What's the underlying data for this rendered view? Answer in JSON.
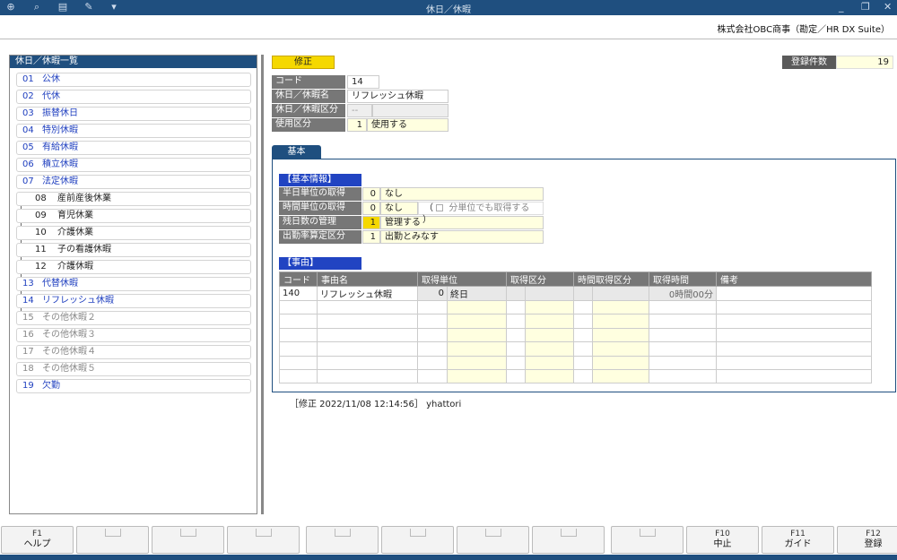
{
  "window": {
    "title": "休日／休暇"
  },
  "toolbar": {
    "icons": [
      "zoom-in-icon",
      "search-icon",
      "print-icon",
      "tools-icon",
      "dropdown-icon"
    ]
  },
  "company": "株式会社OBC商事（勘定／HR DX Suite）",
  "left_panel": {
    "title": "休日／休暇一覧",
    "items": [
      {
        "code": "01",
        "name": "公休"
      },
      {
        "code": "02",
        "name": "代休"
      },
      {
        "code": "03",
        "name": "振替休日"
      },
      {
        "code": "04",
        "name": "特別休暇"
      },
      {
        "code": "05",
        "name": "有給休暇"
      },
      {
        "code": "06",
        "name": "積立休暇"
      },
      {
        "code": "07",
        "name": "法定休暇"
      },
      {
        "code": "08",
        "name": "産前産後休業"
      },
      {
        "code": "09",
        "name": "育児休業"
      },
      {
        "code": "10",
        "name": "介護休業"
      },
      {
        "code": "11",
        "name": "子の看護休暇"
      },
      {
        "code": "12",
        "name": "介護休暇"
      },
      {
        "code": "13",
        "name": "代替休暇"
      },
      {
        "code": "14",
        "name": "リフレッシュ休暇"
      },
      {
        "code": "15",
        "name": "その他休暇２"
      },
      {
        "code": "16",
        "name": "その他休暇３"
      },
      {
        "code": "17",
        "name": "その他休暇４"
      },
      {
        "code": "18",
        "name": "その他休暇５"
      },
      {
        "code": "19",
        "name": "欠勤"
      }
    ]
  },
  "mode": "修正",
  "count": {
    "label": "登録件数",
    "value": "19"
  },
  "header_fields": {
    "code_label": "コード",
    "code_value": "14",
    "name_label": "休日／休暇名",
    "name_value": "リフレッシュ休暇",
    "kbn_label": "休日／休暇区分",
    "kbn_value": "--",
    "use_label": "使用区分",
    "use_num": "1",
    "use_value": "使用する"
  },
  "tab": "基本",
  "basic": {
    "section": "【基本情報】",
    "rows": [
      {
        "label": "半日単位の取得",
        "num": "0",
        "value": "なし"
      },
      {
        "label": "時間単位の取得",
        "num": "0",
        "value": "なし"
      },
      {
        "label": "残日数の管理",
        "num": "1",
        "value": "管理する"
      },
      {
        "label": "出勤率算定区分",
        "num": "1",
        "value": "出勤とみなす"
      }
    ],
    "checkbox_label": "分単位でも取得する",
    "paren_open": "（",
    "paren_close": "）"
  },
  "jiyu": {
    "section": "【事由】",
    "columns": [
      "コード",
      "事由名",
      "取得単位",
      "取得区分",
      "時間取得区分",
      "取得時間",
      "備考"
    ],
    "row": {
      "code": "140",
      "name": "リフレッシュ休暇",
      "unit_num": "0",
      "unit": "終日",
      "time": "0時間00分"
    }
  },
  "footer_info": "［修正  2022/11/08 12:14:56］ yhattori",
  "fkeys": [
    {
      "n": "F1",
      "l": "ヘルプ"
    },
    {
      "n": "",
      "l": ""
    },
    {
      "n": "",
      "l": ""
    },
    {
      "n": "",
      "l": ""
    },
    {
      "n": "",
      "l": ""
    },
    {
      "n": "",
      "l": ""
    },
    {
      "n": "",
      "l": ""
    },
    {
      "n": "",
      "l": ""
    },
    {
      "n": "",
      "l": ""
    },
    {
      "n": "F10",
      "l": "中止"
    },
    {
      "n": "F11",
      "l": "ガイド"
    },
    {
      "n": "F12",
      "l": "登録"
    }
  ]
}
